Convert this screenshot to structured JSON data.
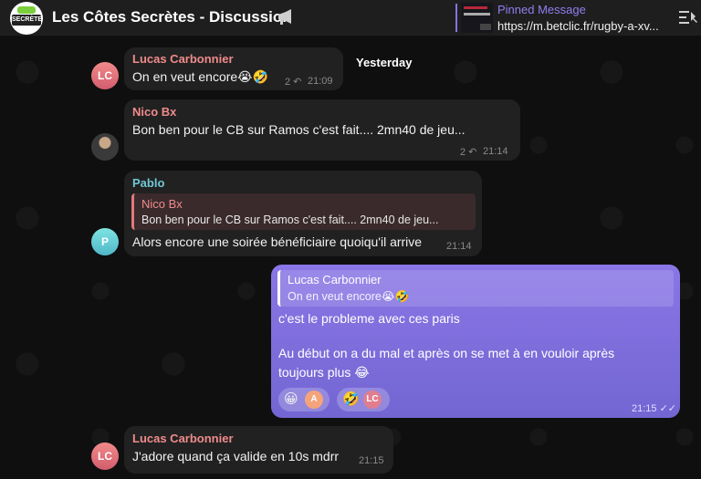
{
  "header": {
    "title": "Les Côtes Secrètes - Discussion",
    "pinned_title": "Pinned Message",
    "pinned_text": "https://m.betclic.fr/rugby-a-xv..."
  },
  "date_separator": "Yesterday",
  "messages": [
    {
      "sender": "Lucas Carbonnier",
      "avatar": "LC",
      "text": "On en veut encore😭🤣",
      "reply_count": "2",
      "time": "21:09"
    },
    {
      "sender": "Nico Bx",
      "text": "Bon ben pour le CB sur Ramos c'est fait.... 2mn40 de jeu...",
      "reply_count": "2",
      "time": "21:14"
    },
    {
      "sender": "Pablo",
      "avatar": "P",
      "quote_sender": "Nico Bx",
      "quote_text": "Bon ben pour le CB sur Ramos c'est fait.... 2mn40 de jeu...",
      "text": "Alors encore une soirée bénéficiaire quoiqu'il arrive",
      "time": "21:14"
    },
    {
      "sender": "Lucas Carbonnier",
      "avatar": "LC",
      "text": "J'adore quand ça valide en 10s mdrr",
      "time": "21:15"
    }
  ],
  "outgoing": {
    "quote_sender": "Lucas Carbonnier",
    "quote_text": "On en veut encore😭🤣",
    "line1": "c'est le probleme avec ces paris",
    "line2": "Au début on a du mal et après on se met à en vouloir après",
    "line3": "toujours plus 😂",
    "reactions": [
      {
        "emoji": "😀",
        "avatar": "A"
      },
      {
        "emoji": "🤣",
        "avatar": "LC"
      }
    ],
    "time": "21:15"
  },
  "colors": {
    "accent": "#8774e1",
    "bubble_in": "#212121",
    "name_red": "#f08b8b",
    "name_teal": "#6fc8d4"
  }
}
